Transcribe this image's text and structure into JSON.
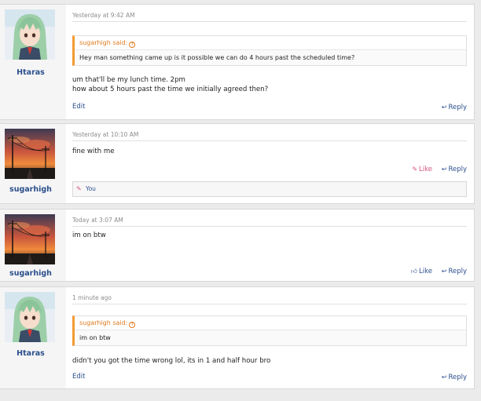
{
  "posts": [
    {
      "username": "Htaras",
      "avatar": "anime-character",
      "timestamp": "Yesterday at 9:42 AM",
      "quote": {
        "author": "sugarhigh said:",
        "text": "Hey man something came up is it possible we can do 4 hours past the scheduled time?"
      },
      "message_lines": [
        "um that'll be my lunch time. 2pm",
        "how about 5 hours past the time we initially agreed then?"
      ],
      "edit_label": "Edit",
      "reply_label": "Reply"
    },
    {
      "username": "sugarhigh",
      "avatar": "sunset-power-lines",
      "timestamp": "Yesterday at 10:10 AM",
      "message_lines": [
        "fine with me"
      ],
      "like_label": "Like",
      "reply_label": "Reply",
      "liked_by": "You"
    },
    {
      "username": "sugarhigh",
      "avatar": "sunset-power-lines",
      "timestamp": "Today at 3:07 AM",
      "message_lines": [
        "im on btw"
      ],
      "like_label": "Like",
      "reply_label": "Reply"
    },
    {
      "username": "Htaras",
      "avatar": "anime-character",
      "timestamp": "1 minute ago",
      "quote": {
        "author": "sugarhigh said:",
        "text": "im on btw"
      },
      "message_lines": [
        "didn't you got the time wrong lol, its in 1 and half hour bro"
      ],
      "edit_label": "Edit",
      "reply_label": "Reply"
    }
  ],
  "colors": {
    "link": "#2b4f8c",
    "quote_accent": "#f39a32",
    "liked": "#d4557f"
  }
}
